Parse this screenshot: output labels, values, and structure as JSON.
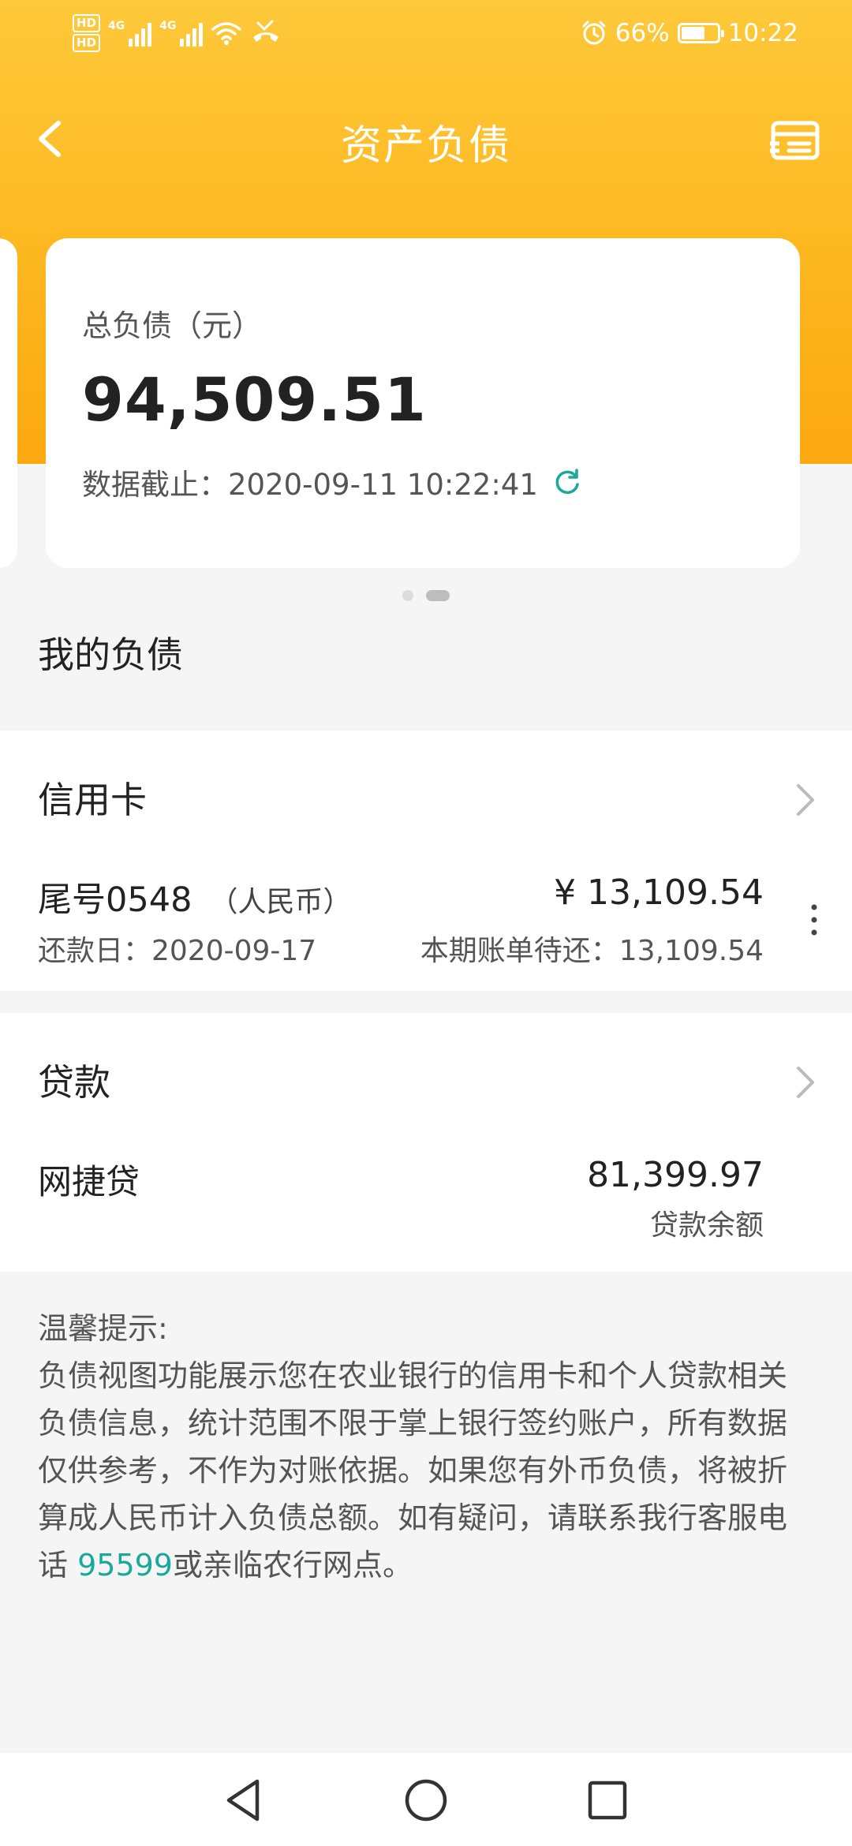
{
  "status_bar": {
    "hd_top": "HD",
    "hd_bottom": "HD",
    "sim1_label": "4G",
    "sim2_label": "4G",
    "battery_percent": "66%",
    "battery_level": 0.66,
    "time": "10:22",
    "icons": [
      "signal-icon",
      "wifi-icon",
      "missed-call-icon",
      "alarm-icon",
      "battery-icon"
    ]
  },
  "nav": {
    "title": "资产负债"
  },
  "summary_card": {
    "label": "总负债（元）",
    "amount": "94,509.51",
    "timestamp": "数据截止：2020-09-11 10:22:41"
  },
  "carousel": {
    "page_count": 2,
    "active_index": 1
  },
  "section_title": "我的负债",
  "credit_card": {
    "title": "信用卡",
    "card_tail": "尾号0548",
    "currency": "（人民币）",
    "amount": "¥ 13,109.54",
    "due_date": "还款日：2020-09-17",
    "bill_due": "本期账单待还：13,109.54"
  },
  "loan": {
    "title": "贷款",
    "name": "网捷贷",
    "amount": "81,399.97",
    "amount_label": "贷款余额"
  },
  "tips": {
    "heading": "温馨提示:",
    "body_before": "负债视图功能展示您在农业银行的信用卡和个人贷款相关负债信息，统计范围不限于掌上银行签约账户，所有数据仅供参考，不作为对账依据。如果您有外币负债，将被折算成人民币计入负债总额。如有疑问，请联系我行客服电话 ",
    "phone": "95599",
    "body_after": "或亲临农行网点。"
  },
  "colors": {
    "header_top": "#fec93a",
    "header_bottom": "#fca80f",
    "accent_teal": "#1aa89a",
    "background": "#f5f5f5"
  }
}
